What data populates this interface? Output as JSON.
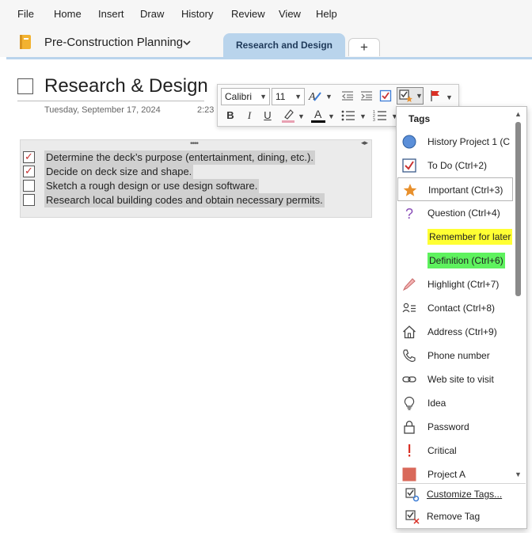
{
  "menu": [
    "File",
    "Home",
    "Insert",
    "Draw",
    "History",
    "Review",
    "View",
    "Help"
  ],
  "notebook": {
    "name": "Pre-Construction Planning"
  },
  "tabs": {
    "active": "Research and Design",
    "add": "+"
  },
  "page": {
    "title": "Research & Design",
    "date": "Tuesday, September 17, 2024",
    "time": "2:23"
  },
  "todos": [
    {
      "text": "Determine the deck’s purpose (entertainment, dining, etc.).",
      "checked": true
    },
    {
      "text": "Decide on deck size and shape.",
      "checked": true
    },
    {
      "text": "Sketch a rough design or use design software.",
      "checked": false
    },
    {
      "text": "Research local building codes and obtain necessary permits.",
      "checked": false
    }
  ],
  "toolbar": {
    "font": "Calibri",
    "size": "11",
    "bold": "B",
    "italic": "I",
    "underline": "U",
    "font_color_letter": "A",
    "colors": {
      "highlight": "#e8a1b3",
      "font": "#000000",
      "flag": "#d93025"
    }
  },
  "tags": {
    "heading": "Tags",
    "items": [
      {
        "label": "History Project 1 (C",
        "icon": "circle-icon"
      },
      {
        "label": "To Do (Ctrl+2)",
        "icon": "checkbox-icon"
      },
      {
        "label": "Important (Ctrl+3)",
        "icon": "star-icon"
      },
      {
        "label": "Question (Ctrl+4)",
        "icon": "question-icon"
      },
      {
        "label": "Remember for later",
        "icon": "highlight-yellow",
        "highlight": "#ffff33"
      },
      {
        "label": "Definition (Ctrl+6)",
        "icon": "highlight-green",
        "highlight": "#5ef25e"
      },
      {
        "label": "Highlight (Ctrl+7)",
        "icon": "highlighter-icon"
      },
      {
        "label": "Contact (Ctrl+8)",
        "icon": "contact-icon"
      },
      {
        "label": "Address (Ctrl+9)",
        "icon": "house-icon"
      },
      {
        "label": "Phone number",
        "icon": "phone-icon"
      },
      {
        "label": "Web site to visit",
        "icon": "link-icon"
      },
      {
        "label": "Idea",
        "icon": "lightbulb-icon"
      },
      {
        "label": "Password",
        "icon": "lock-icon"
      },
      {
        "label": "Critical",
        "icon": "exclamation-icon"
      },
      {
        "label": "Project A",
        "icon": "square-icon"
      }
    ],
    "footer": [
      {
        "label": "Customize Tags...",
        "icon": "customize-tags-icon"
      },
      {
        "label": "Remove Tag",
        "icon": "remove-tag-icon"
      }
    ]
  }
}
